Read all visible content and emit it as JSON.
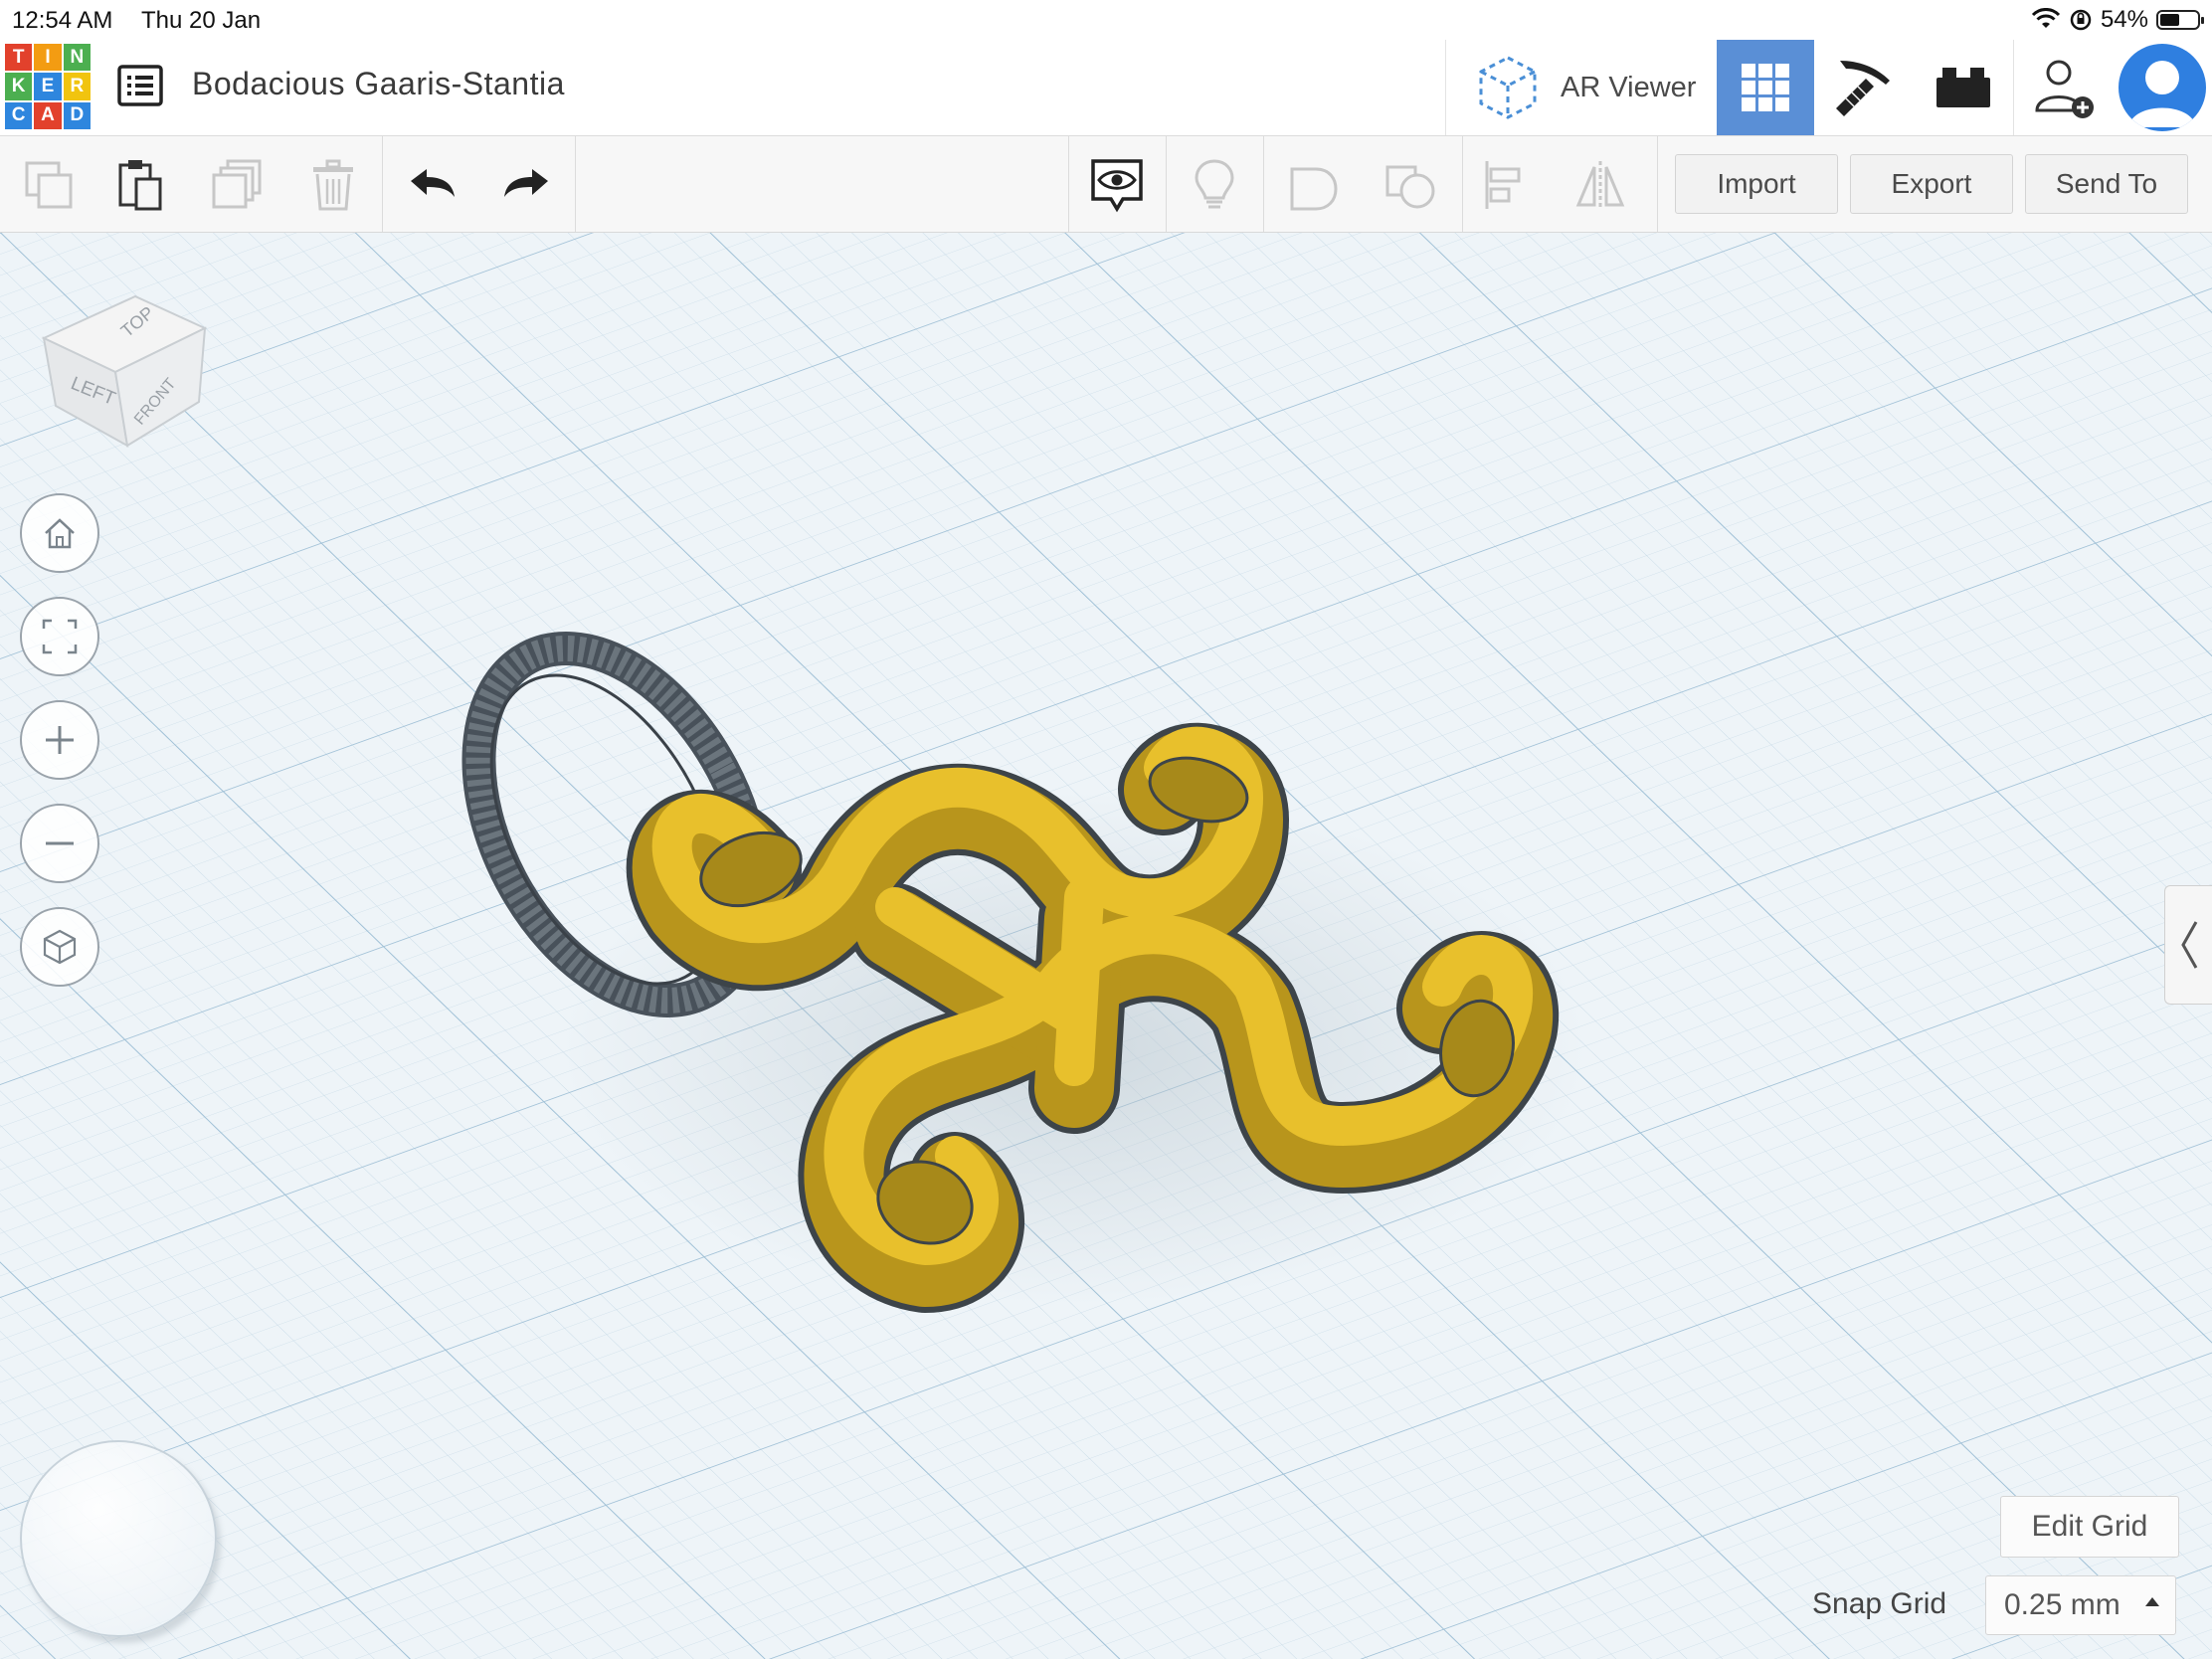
{
  "status_bar": {
    "time": "12:54 AM",
    "date": "Thu 20 Jan",
    "battery": "54%",
    "battery_level": 0.54
  },
  "app": {
    "logo_letters": [
      "T",
      "I",
      "N",
      "K",
      "E",
      "R",
      "C",
      "A",
      "D"
    ],
    "logo_colors": [
      "#e2412c",
      "#f39c12",
      "#4caf50",
      "#4caf50",
      "#2e86de",
      "#f1c40f",
      "#2e86de",
      "#e2412c",
      "#2e86de"
    ],
    "design_title": "Bodacious Gaaris-Stantia"
  },
  "header": {
    "ar_viewer_label": "AR Viewer",
    "active_view": "3d-design",
    "accent_color": "#5a8fd6"
  },
  "toolbar": {
    "import_label": "Import",
    "export_label": "Export",
    "send_to_label": "Send To"
  },
  "viewcube": {
    "top": "TOP",
    "left": "LEFT",
    "front": "FRONT"
  },
  "workplane": {
    "edit_grid_label": "Edit Grid",
    "snap_grid_label": "Snap Grid",
    "snap_grid_value": "0.25 mm",
    "object_color": "#e8c02c"
  }
}
